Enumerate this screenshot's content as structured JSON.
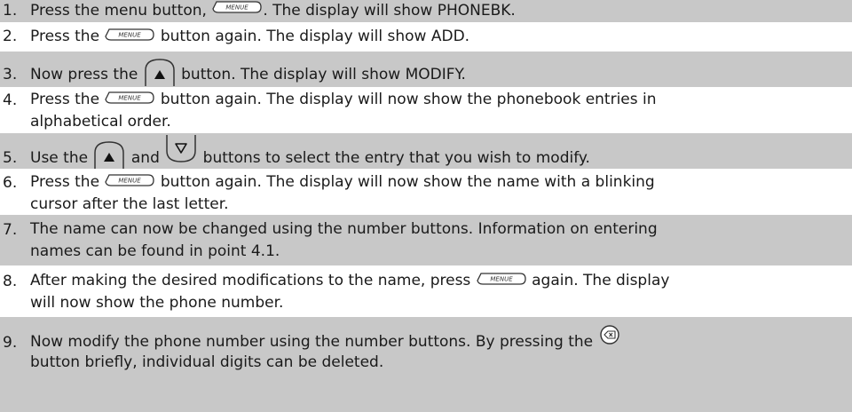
{
  "menu_key_label": "MENUE",
  "steps": [
    {
      "num": "1.",
      "pre": "Press the menu button, ",
      "post": ". The display will show PHONEBK."
    },
    {
      "num": "2.",
      "pre": "Press the ",
      "post": " button again. The display will show ADD."
    },
    {
      "num": "3.",
      "pre": "Now press the ",
      "post": " button. The display will show MODIFY."
    },
    {
      "num": "4.",
      "pre": "Press the ",
      "post": " button again. The display will now show the phonebook entries in",
      "line2": "alphabetical order."
    },
    {
      "num": "5.",
      "pre": "Use the ",
      "mid": " and ",
      "post": " buttons to select the entry that you wish to modify."
    },
    {
      "num": "6.",
      "pre": "Press the ",
      "post": " button again. The display will now show the name with a blinking",
      "line2": "cursor after the last letter."
    },
    {
      "num": "7.",
      "text": "The name can now be changed using the number buttons. Information on entering",
      "line2": "names can be found in point 4.1."
    },
    {
      "num": "8.",
      "pre": "After making the desired modifications to the name, press ",
      "post": " again. The display",
      "line2": "will now show the phone number."
    },
    {
      "num": "9.",
      "pre": "Now modify the phone number using the number buttons. By pressing the ",
      "post": "",
      "line2": "button briefly, individual digits can be deleted."
    }
  ]
}
